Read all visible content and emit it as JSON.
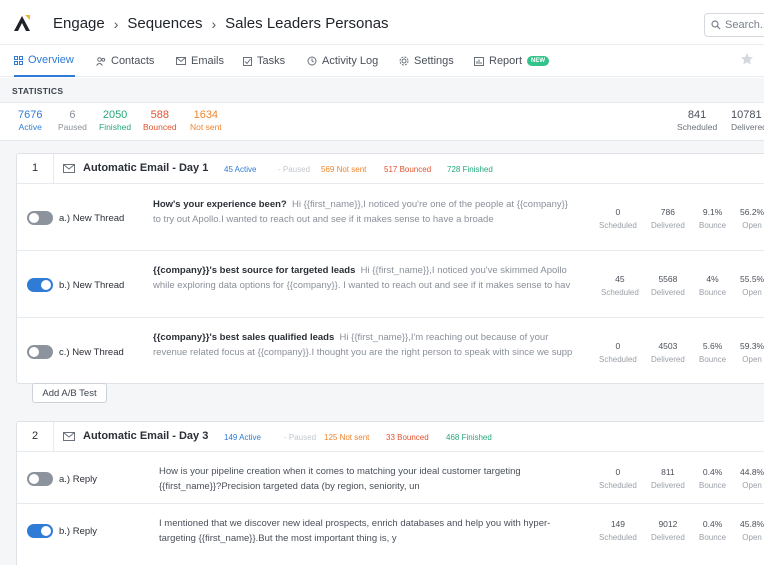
{
  "breadcrumb": {
    "root": "Engage",
    "parent": "Sequences",
    "current": "Sales Leaders Personas"
  },
  "search": {
    "placeholder": "Search..."
  },
  "tabs": [
    {
      "label": "Overview",
      "icon": "grid-icon",
      "active": true
    },
    {
      "label": "Contacts",
      "icon": "people-icon"
    },
    {
      "label": "Emails",
      "icon": "envelope-icon"
    },
    {
      "label": "Tasks",
      "icon": "checkbox-icon"
    },
    {
      "label": "Activity Log",
      "icon": "history-icon"
    },
    {
      "label": "Settings",
      "icon": "gear-icon"
    },
    {
      "label": "Report",
      "icon": "bar-chart-icon",
      "badge": "NEW"
    }
  ],
  "statistics": {
    "title": "STATISTICS",
    "items": [
      {
        "value": "7676",
        "label": "Active",
        "color": "#2f7bd6"
      },
      {
        "value": "6",
        "label": "Paused",
        "color": "#8a9099"
      },
      {
        "value": "2050",
        "label": "Finished",
        "color": "#26a879"
      },
      {
        "value": "588",
        "label": "Bounced",
        "color": "#e0532f"
      },
      {
        "value": "1634",
        "label": "Not sent",
        "color": "#f0852d"
      },
      {
        "value": "841",
        "label": "Scheduled",
        "color": "#4a5059"
      },
      {
        "value": "10781",
        "label": "Delivered",
        "color": "#4a5059"
      }
    ]
  },
  "steps": [
    {
      "number": "1",
      "title": "Automatic Email - Day 1",
      "header_stats": {
        "active": "45 Active",
        "paused": "- Paused",
        "not_sent": "569 Not sent",
        "bounced": "517 Bounced",
        "finished": "728 Finished"
      },
      "rows": [
        {
          "toggle_on": false,
          "variant": "a.) New Thread",
          "subject": "How's your experience been?",
          "preview": "Hi {{first_name}},I noticed you're one of the people at {{company}} to try out Apollo.I wanted to reach out and see if it makes sense to have a broade",
          "scheduled": "0",
          "delivered": "786",
          "bounce": "9.1%",
          "open": "56.2%"
        },
        {
          "toggle_on": true,
          "variant": "b.) New Thread",
          "subject": "{{company}}'s best source for targeted leads",
          "preview": "Hi {{first_name}},I noticed you've skimmed Apollo while exploring data options for {{company}}. I wanted to reach out and see if it makes sense to hav",
          "scheduled": "45",
          "delivered": "5568",
          "bounce": "4%",
          "open": "55.5%"
        },
        {
          "toggle_on": false,
          "variant": "c.) New Thread",
          "subject": "{{company}}'s best sales qualified leads",
          "preview": "Hi {{first_name}},I'm reaching out because of your revenue related focus at {{company}}.I thought you are the right person to speak with since we supp",
          "scheduled": "0",
          "delivered": "4503",
          "bounce": "5.6%",
          "open": "59.3%"
        }
      ]
    },
    {
      "number": "2",
      "title": "Automatic Email - Day 3",
      "header_stats": {
        "active": "149 Active",
        "paused": "- Paused",
        "not_sent": "125 Not sent",
        "bounced": "33 Bounced",
        "finished": "468 Finished"
      },
      "rows": [
        {
          "toggle_on": false,
          "variant": "a.) Reply",
          "preview": "How is your pipeline creation when it comes to matching your ideal customer targeting {{first_name}}?Precision targeted data (by region, seniority, un",
          "scheduled": "0",
          "delivered": "811",
          "bounce": "0.4%",
          "open": "44.8%"
        },
        {
          "toggle_on": true,
          "variant": "b.) Reply",
          "preview": "I mentioned that we discover new ideal prospects, enrich databases and help you with hyper-targeting {{first_name}}.But the most important thing is, y",
          "scheduled": "149",
          "delivered": "9012",
          "bounce": "0.4%",
          "open": "45.8%"
        }
      ]
    }
  ],
  "row_stat_labels": {
    "scheduled": "Scheduled",
    "delivered": "Delivered",
    "bounce": "Bounce",
    "open": "Open"
  },
  "ab_test_button": "Add A/B Test",
  "colors": {
    "accent": "#2f7bd6",
    "finished": "#26a879",
    "bounced": "#e0532f",
    "not_sent": "#f0852d"
  }
}
